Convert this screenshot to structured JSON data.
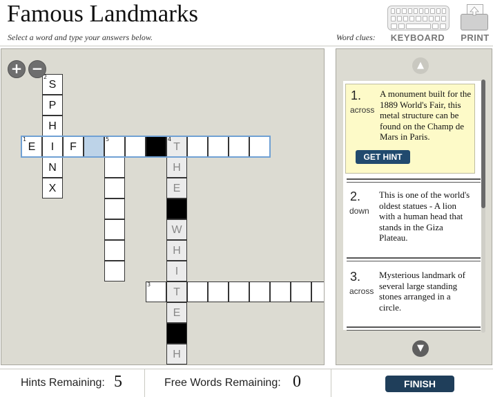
{
  "header": {
    "title": "Famous Landmarks",
    "subtitle": "Select a word and type your answers below.",
    "word_clues_label": "Word clues:",
    "keyboard_label": "KEYBOARD",
    "print_label": "PRINT",
    "keyboard_icon": "keyboard-icon",
    "print_icon": "printer-icon"
  },
  "board": {
    "zoom_in_icon": "+",
    "zoom_out_icon": "−",
    "active_word": "1-across",
    "cells": [
      {
        "row": 0,
        "col": 1,
        "num": "2",
        "letter": "S"
      },
      {
        "row": 1,
        "col": 1,
        "letter": "P"
      },
      {
        "row": 2,
        "col": 1,
        "letter": "H"
      },
      {
        "row": 3,
        "col": 0,
        "num": "1",
        "letter": "E"
      },
      {
        "row": 3,
        "col": 1,
        "letter": "I"
      },
      {
        "row": 3,
        "col": 2,
        "letter": "F"
      },
      {
        "row": 3,
        "col": 3,
        "letter": "",
        "state": "current"
      },
      {
        "row": 3,
        "col": 4,
        "num": "5",
        "letter": ""
      },
      {
        "row": 3,
        "col": 5,
        "letter": ""
      },
      {
        "row": 3,
        "col": 6,
        "letter": "",
        "state": "black"
      },
      {
        "row": 3,
        "col": 7,
        "num": "4",
        "letter": "T",
        "state": "hint"
      },
      {
        "row": 3,
        "col": 8,
        "letter": ""
      },
      {
        "row": 3,
        "col": 9,
        "letter": ""
      },
      {
        "row": 3,
        "col": 10,
        "letter": ""
      },
      {
        "row": 3,
        "col": 11,
        "letter": ""
      },
      {
        "row": 4,
        "col": 1,
        "letter": "N"
      },
      {
        "row": 5,
        "col": 1,
        "letter": "X"
      },
      {
        "row": 4,
        "col": 4,
        "letter": ""
      },
      {
        "row": 5,
        "col": 4,
        "letter": ""
      },
      {
        "row": 6,
        "col": 4,
        "letter": ""
      },
      {
        "row": 7,
        "col": 4,
        "letter": ""
      },
      {
        "row": 8,
        "col": 4,
        "letter": ""
      },
      {
        "row": 9,
        "col": 4,
        "letter": ""
      },
      {
        "row": 4,
        "col": 7,
        "letter": "H",
        "state": "hint"
      },
      {
        "row": 5,
        "col": 7,
        "letter": "E",
        "state": "hint"
      },
      {
        "row": 6,
        "col": 7,
        "letter": "",
        "state": "black"
      },
      {
        "row": 7,
        "col": 7,
        "letter": "W",
        "state": "hint"
      },
      {
        "row": 8,
        "col": 7,
        "letter": "H",
        "state": "hint"
      },
      {
        "row": 9,
        "col": 7,
        "letter": "I",
        "state": "hint"
      },
      {
        "row": 10,
        "col": 6,
        "num": "3",
        "letter": ""
      },
      {
        "row": 10,
        "col": 7,
        "letter": "T",
        "state": "hint"
      },
      {
        "row": 10,
        "col": 8,
        "letter": ""
      },
      {
        "row": 10,
        "col": 9,
        "letter": ""
      },
      {
        "row": 10,
        "col": 10,
        "letter": ""
      },
      {
        "row": 10,
        "col": 11,
        "letter": ""
      },
      {
        "row": 10,
        "col": 12,
        "letter": ""
      },
      {
        "row": 10,
        "col": 13,
        "letter": ""
      },
      {
        "row": 10,
        "col": 14,
        "letter": ""
      },
      {
        "row": 11,
        "col": 7,
        "letter": "E",
        "state": "hint"
      },
      {
        "row": 12,
        "col": 7,
        "letter": "",
        "state": "black"
      },
      {
        "row": 13,
        "col": 7,
        "letter": "H",
        "state": "hint"
      }
    ]
  },
  "clues": {
    "scroll_up_icon": "▲",
    "scroll_down_icon": "▼",
    "hint_label": "GET HINT",
    "items": [
      {
        "number": "1.",
        "direction": "across",
        "text": "A monument built for the 1889 World's Fair, this metal structure can be found on the Champ de Mars in Paris.",
        "active": true
      },
      {
        "number": "2.",
        "direction": "down",
        "text": "This is one of the world's oldest statues - A lion with a human head that stands in the Giza Plateau.",
        "active": false
      },
      {
        "number": "3.",
        "direction": "across",
        "text": "Mysterious landmark of several large standing stones arranged in a circle.",
        "active": false
      }
    ]
  },
  "footer": {
    "hints_label": "Hints Remaining:",
    "hints_value": "5",
    "free_words_label": "Free Words Remaining:",
    "free_words_value": "0",
    "finish_label": "FINISH"
  }
}
